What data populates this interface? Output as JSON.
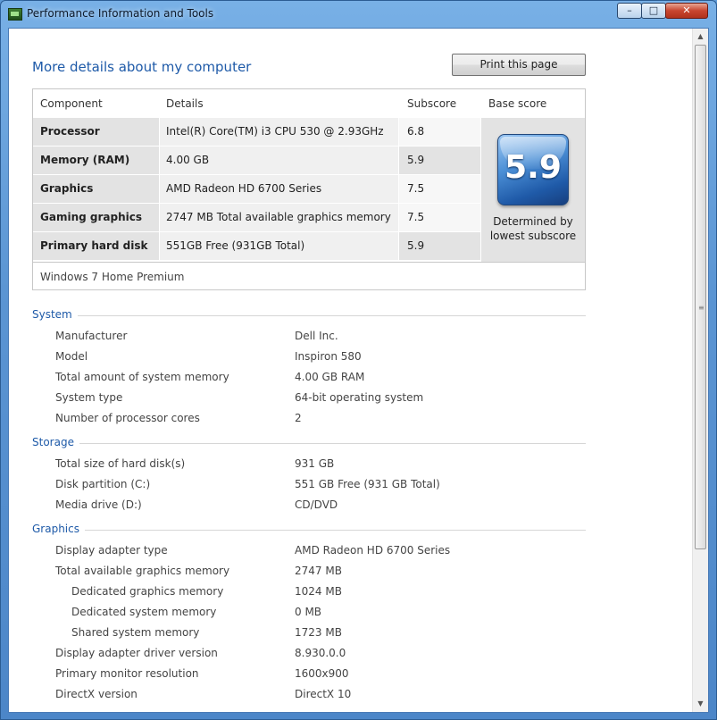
{
  "window": {
    "title": "Performance Information and Tools",
    "minimize_glyph": "–",
    "maximize_glyph": "□",
    "close_glyph": "✕"
  },
  "heading": "More details about my computer",
  "print_button": "Print this page",
  "score_table": {
    "headers": {
      "component": "Component",
      "details": "Details",
      "subscore": "Subscore",
      "base_score": "Base score"
    },
    "rows": [
      {
        "component": "Processor",
        "details": "Intel(R) Core(TM) i3 CPU 530 @ 2.93GHz",
        "subscore": "6.8"
      },
      {
        "component": "Memory (RAM)",
        "details": "4.00 GB",
        "subscore": "5.9"
      },
      {
        "component": "Graphics",
        "details": "AMD Radeon HD 6700 Series",
        "subscore": "7.5"
      },
      {
        "component": "Gaming graphics",
        "details": "2747 MB Total available graphics memory",
        "subscore": "7.5"
      },
      {
        "component": "Primary hard disk",
        "details": "551GB Free (931GB Total)",
        "subscore": "5.9"
      }
    ],
    "base_score": "5.9",
    "base_note_line1": "Determined by",
    "base_note_line2": "lowest subscore",
    "os": "Windows 7 Home Premium"
  },
  "sections": {
    "system": {
      "title": "System",
      "props": [
        {
          "name": "Manufacturer",
          "value": "Dell Inc."
        },
        {
          "name": "Model",
          "value": "Inspiron 580"
        },
        {
          "name": "Total amount of system memory",
          "value": "4.00 GB RAM"
        },
        {
          "name": "System type",
          "value": "64-bit operating system"
        },
        {
          "name": "Number of processor cores",
          "value": "2"
        }
      ]
    },
    "storage": {
      "title": "Storage",
      "props": [
        {
          "name": "Total size of hard disk(s)",
          "value": "931 GB"
        },
        {
          "name": "Disk partition (C:)",
          "value": "551 GB Free (931 GB Total)"
        },
        {
          "name": "Media drive (D:)",
          "value": "CD/DVD"
        }
      ]
    },
    "graphics": {
      "title": "Graphics",
      "props": [
        {
          "name": "Display adapter type",
          "value": "AMD Radeon HD 6700 Series"
        },
        {
          "name": "Total available graphics memory",
          "value": "2747 MB"
        },
        {
          "name": "Dedicated graphics memory",
          "value": "1024 MB"
        },
        {
          "name": "Dedicated system memory",
          "value": "0 MB"
        },
        {
          "name": "Shared system memory",
          "value": "1723 MB"
        },
        {
          "name": "Display adapter driver version",
          "value": "8.930.0.0"
        },
        {
          "name": "Primary monitor resolution",
          "value": "1600x900"
        },
        {
          "name": "DirectX version",
          "value": "DirectX 10"
        }
      ]
    }
  },
  "icons": {
    "app": "performance-monitor-icon",
    "scroll_up": "▲",
    "scroll_down": "▼",
    "grip": "≡"
  },
  "colors": {
    "heading": "#1e5aa8",
    "badge": "#1f5aa8"
  }
}
